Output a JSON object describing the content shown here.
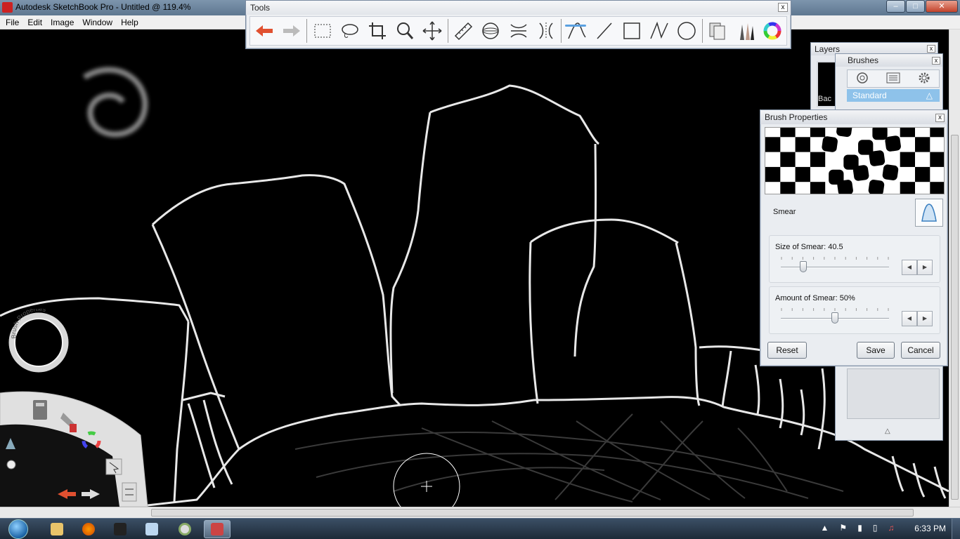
{
  "window": {
    "title": "Autodesk SketchBook Pro - Untitled @ 119.4%",
    "min_label": "–",
    "max_label": "□",
    "close_label": "✕"
  },
  "menu": [
    "File",
    "Edit",
    "Image",
    "Window",
    "Help"
  ],
  "tools_panel": {
    "title": "Tools",
    "close": "x",
    "items": [
      "undo-icon",
      "redo-icon",
      "rectangle-select-icon",
      "lasso-select-icon",
      "crop-icon",
      "zoom-icon",
      "move-icon",
      "ruler-icon",
      "ellipse-guide-icon",
      "symmetry-x-icon",
      "symmetry-y-icon",
      "pen-stroke-icon",
      "line-icon",
      "rectangle-icon",
      "polyline-icon",
      "ellipse-icon",
      "copy-layers-icon",
      "brushes-icon",
      "color-wheel-icon"
    ]
  },
  "layers_panel": {
    "title": "Layers",
    "close": "x",
    "layer_label": "Bac"
  },
  "brushes_panel": {
    "title": "Brushes",
    "close": "x",
    "set_name": "Standard",
    "icons": [
      "brush-library-icon",
      "brush-settings-icon",
      "brush-gear-icon"
    ]
  },
  "brush_properties": {
    "title": "Brush Properties",
    "close": "x",
    "brush_name": "Smear",
    "size": {
      "label": "Size of Smear: 40.5",
      "value_fraction": 0.21
    },
    "amount": {
      "label": "Amount of Smear: 50%",
      "value_fraction": 0.5
    },
    "buttons": {
      "reset": "Reset",
      "save": "Save",
      "cancel": "Cancel"
    }
  },
  "lagoon": {
    "ring_label": "Brush Properties",
    "icons": [
      "toolbox-icon",
      "brush-icon",
      "color-wheel-icon",
      "cursor-icon",
      "undo-icon",
      "redo-icon",
      "swap-icon"
    ]
  },
  "taskbar": {
    "clock": "6:33 PM",
    "apps": [
      "explorer-icon",
      "firefox-icon",
      "media-icon",
      "notepad-icon",
      "chrome-icon",
      "sketchbook-icon"
    ],
    "active_app": "sketchbook-icon"
  }
}
